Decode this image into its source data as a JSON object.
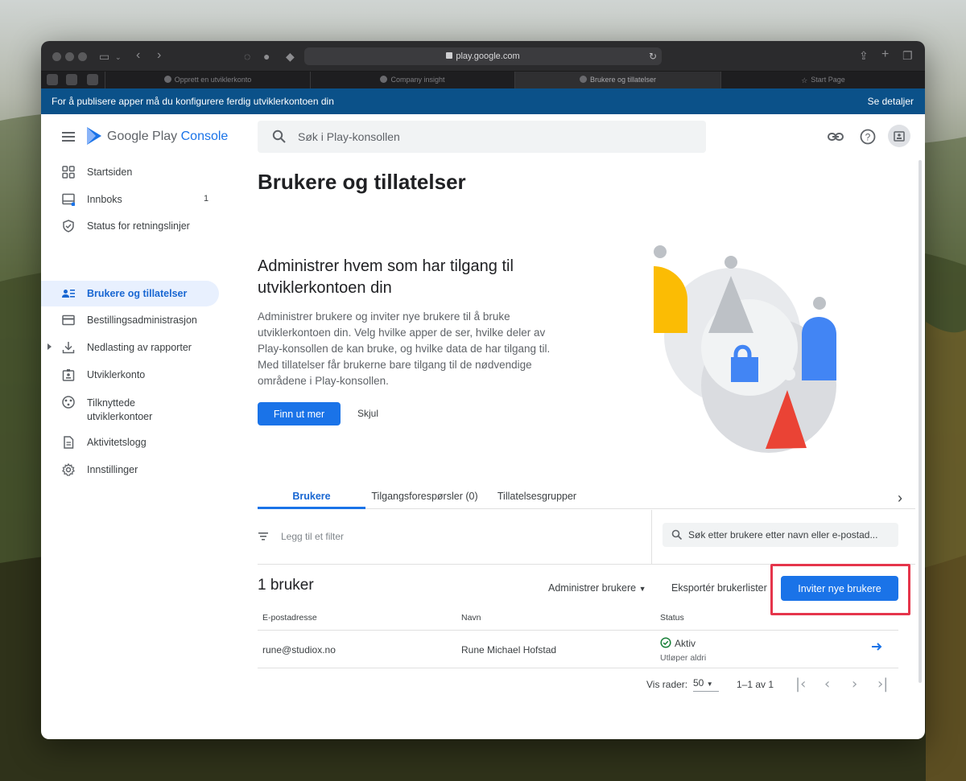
{
  "browser": {
    "url": "play.google.com",
    "tabs": [
      {
        "label": "Opprett en utviklerkonto",
        "active": false
      },
      {
        "label": "Company insight",
        "active": false
      },
      {
        "label": "Brukere og tillatelser",
        "active": true
      },
      {
        "label": "Start Page",
        "active": false
      }
    ]
  },
  "banner": {
    "message": "For å publisere apper må du konfigurere ferdig utviklerkontoen din",
    "link": "Se detaljer"
  },
  "header": {
    "logo_main": "Google Play",
    "logo_accent": "Console",
    "search_placeholder": "Søk i Play-konsollen"
  },
  "sidebar": {
    "items": [
      {
        "label": "Startsiden",
        "icon": "dashboard-icon",
        "active": false
      },
      {
        "label": "Innboks",
        "icon": "inbox-icon",
        "badge": "1",
        "active": false
      },
      {
        "label": "Status for retningslinjer",
        "icon": "shield-icon",
        "active": false
      },
      {
        "label": "Brukere og tillatelser",
        "icon": "users-icon",
        "active": true
      },
      {
        "label": "Bestillingsadministrasjon",
        "icon": "credit-card-icon",
        "active": false
      },
      {
        "label": "Nedlasting av rapporter",
        "icon": "download-icon",
        "active": false
      },
      {
        "label": "Utviklerkonto",
        "icon": "badge-icon",
        "active": false
      },
      {
        "label": "Tilknyttede utviklerkontoer",
        "icon": "linked-accounts-icon",
        "active": false
      },
      {
        "label": "Aktivitetslogg",
        "icon": "document-icon",
        "active": false
      },
      {
        "label": "Innstillinger",
        "icon": "gear-icon",
        "active": false
      }
    ]
  },
  "main": {
    "title": "Brukere og tillatelser",
    "hero": {
      "title": "Administrer hvem som har tilgang til utviklerkontoen din",
      "text": "Administrer brukere og inviter nye brukere til å bruke utviklerkontoen din. Velg hvilke apper de ser, hvilke deler av Play-konsollen de kan bruke, og hvilke data de har tilgang til. Med tillatelser får brukerne bare tilgang til de nødvendige områdene i Play-konsollen.",
      "learn_more": "Finn ut mer",
      "hide": "Skjul"
    },
    "tabs": [
      {
        "label": "Brukere",
        "active": true
      },
      {
        "label": "Tilgangsforespørsler (0)",
        "active": false
      },
      {
        "label": "Tillatelsesgrupper",
        "active": false
      }
    ],
    "filter_label": "Legg til et filter",
    "user_search_placeholder": "Søk etter brukere etter navn eller e-postad...",
    "count_title": "1 bruker",
    "manage_users": "Administrer brukere",
    "export_users": "Eksportér brukerlister",
    "invite_users": "Inviter nye brukere",
    "table": {
      "columns": [
        "E-postadresse",
        "Navn",
        "Status"
      ],
      "rows": [
        {
          "email": "rune@studiox.no",
          "name": "Rune Michael Hofstad",
          "status": "Aktiv",
          "expires": "Utløper aldri"
        }
      ]
    },
    "pagination": {
      "rows_label": "Vis rader:",
      "rows_value": "50",
      "range": "1–1 av 1"
    }
  },
  "colors": {
    "accent": "#1a73e8",
    "banner": "#0b5189",
    "highlight": "#e5354b",
    "status_ok": "#188038"
  }
}
